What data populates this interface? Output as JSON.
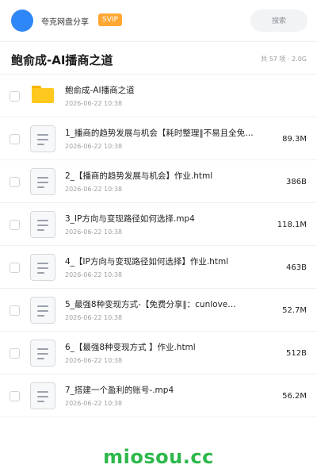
{
  "header": {
    "username": "夸克网盘分享",
    "badge": "SVIP",
    "search_label": "搜索"
  },
  "folder": {
    "title": "鲍俞成-AI播商之道",
    "meta": "共 57 项 · 2.0G"
  },
  "items": [
    {
      "type": "folder",
      "name": "鲍俞成-AI播商之道",
      "date": "2026-06-22 10:38",
      "size": ""
    },
    {
      "type": "file",
      "name": "1_播商的趋势发展与机会【耗时整理‖不易且全免费：…",
      "date": "2026-06-22 10:38",
      "size": "89.3M"
    },
    {
      "type": "file",
      "name": "2_【播商的趋势发展与机会】作业.html",
      "date": "2026-06-22 10:38",
      "size": "386B"
    },
    {
      "type": "file",
      "name": "3_IP方向与变现路径如何选择.mp4",
      "date": "2026-06-22 10:38",
      "size": "118.1M"
    },
    {
      "type": "file",
      "name": "4_【IP方向与变现路径如何选择】作业.html",
      "date": "2026-06-22 10:38",
      "size": "463B"
    },
    {
      "type": "file",
      "name": "5_最强8种变现方式-【免费分享‖：cunlove…",
      "date": "2026-06-22 10:38",
      "size": "52.7M"
    },
    {
      "type": "file",
      "name": "6_【最强8种变现方式 】作业.html",
      "date": "2026-06-22 10:38",
      "size": "512B"
    },
    {
      "type": "file",
      "name": "7_搭建一个盈利的账号-.mp4",
      "date": "2026-06-22 10:38",
      "size": "56.2M"
    }
  ],
  "icons": {
    "folder": "folder-icon",
    "file": "document-icon"
  },
  "colors": {
    "accent": "#2f86f6",
    "svip": "#ffa733",
    "folder": "#ffc81e",
    "watermark": "#2db84b"
  },
  "watermark": "miosou.cc"
}
